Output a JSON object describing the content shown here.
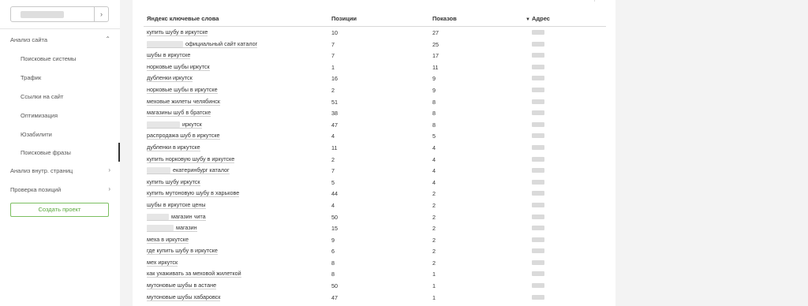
{
  "sidebar": {
    "site_select_chevron": "›",
    "section_analysis": "Анализ сайта",
    "section_analysis_arrow": "⌃",
    "items": [
      {
        "label": "Поисковые системы"
      },
      {
        "label": "Трафик"
      },
      {
        "label": "Ссылки на сайт"
      },
      {
        "label": "Оптимизация"
      },
      {
        "label": "Юзабилити"
      },
      {
        "label": "Поисковые фразы"
      }
    ],
    "section_internal": "Анализ внутр. страниц",
    "section_positions": "Проверка позиций",
    "arrow_right": "›",
    "create_project": "Создать проект"
  },
  "table": {
    "headers": {
      "keyword": "Яндекс ключевые слова",
      "positions": "Позиции",
      "shows": "Показов",
      "address": "Адрес",
      "address_sort_icon": "▼"
    },
    "rows": [
      {
        "keyword": "купить шубу в иркутске",
        "position": "10",
        "shows": "27"
      },
      {
        "keyword": "официальный сайт каталог",
        "position": "7",
        "shows": "25"
      },
      {
        "keyword": "шубы в иркутске",
        "position": "7",
        "shows": "17"
      },
      {
        "keyword": "норковые шубы иркутск",
        "position": "1",
        "shows": "11"
      },
      {
        "keyword": "дубленки иркутск",
        "position": "16",
        "shows": "9"
      },
      {
        "keyword": "норковые шубы в иркутске",
        "position": "2",
        "shows": "9"
      },
      {
        "keyword": "меховые жилеты челябинск",
        "position": "51",
        "shows": "8"
      },
      {
        "keyword": "магазины шуб в братске",
        "position": "38",
        "shows": "8"
      },
      {
        "keyword": "иркутск",
        "position": "47",
        "shows": "8"
      },
      {
        "keyword": "распродажа шуб в иркутске",
        "position": "4",
        "shows": "5"
      },
      {
        "keyword": "дубленки в иркутске",
        "position": "11",
        "shows": "4"
      },
      {
        "keyword": "купить норковую шубу в иркутске",
        "position": "2",
        "shows": "4"
      },
      {
        "keyword": "екатеринбург каталог",
        "position": "7",
        "shows": "4"
      },
      {
        "keyword": "купить шубу иркутск",
        "position": "5",
        "shows": "4"
      },
      {
        "keyword": "купить мутоновую шубу в харькове",
        "position": "44",
        "shows": "2"
      },
      {
        "keyword": "шубы в иркутске цены",
        "position": "4",
        "shows": "2"
      },
      {
        "keyword": "магазин чита",
        "position": "50",
        "shows": "2"
      },
      {
        "keyword": "магазин",
        "position": "15",
        "shows": "2"
      },
      {
        "keyword": "меха в иркутске",
        "position": "9",
        "shows": "2"
      },
      {
        "keyword": "где купить шубу в иркутске",
        "position": "6",
        "shows": "2"
      },
      {
        "keyword": "мех иркутск",
        "position": "8",
        "shows": "2"
      },
      {
        "keyword": "как ухаживать за меховой жилеткой",
        "position": "8",
        "shows": "1"
      },
      {
        "keyword": "мутоновые шубы в астане",
        "position": "50",
        "shows": "1"
      },
      {
        "keyword": "мутоновые шубы хабаровск",
        "position": "47",
        "shows": "1"
      }
    ]
  },
  "colors": {
    "accent_green": "#5aa73d",
    "sidebar_bg": "#ffffff",
    "page_bg": "#f3f3f3"
  }
}
